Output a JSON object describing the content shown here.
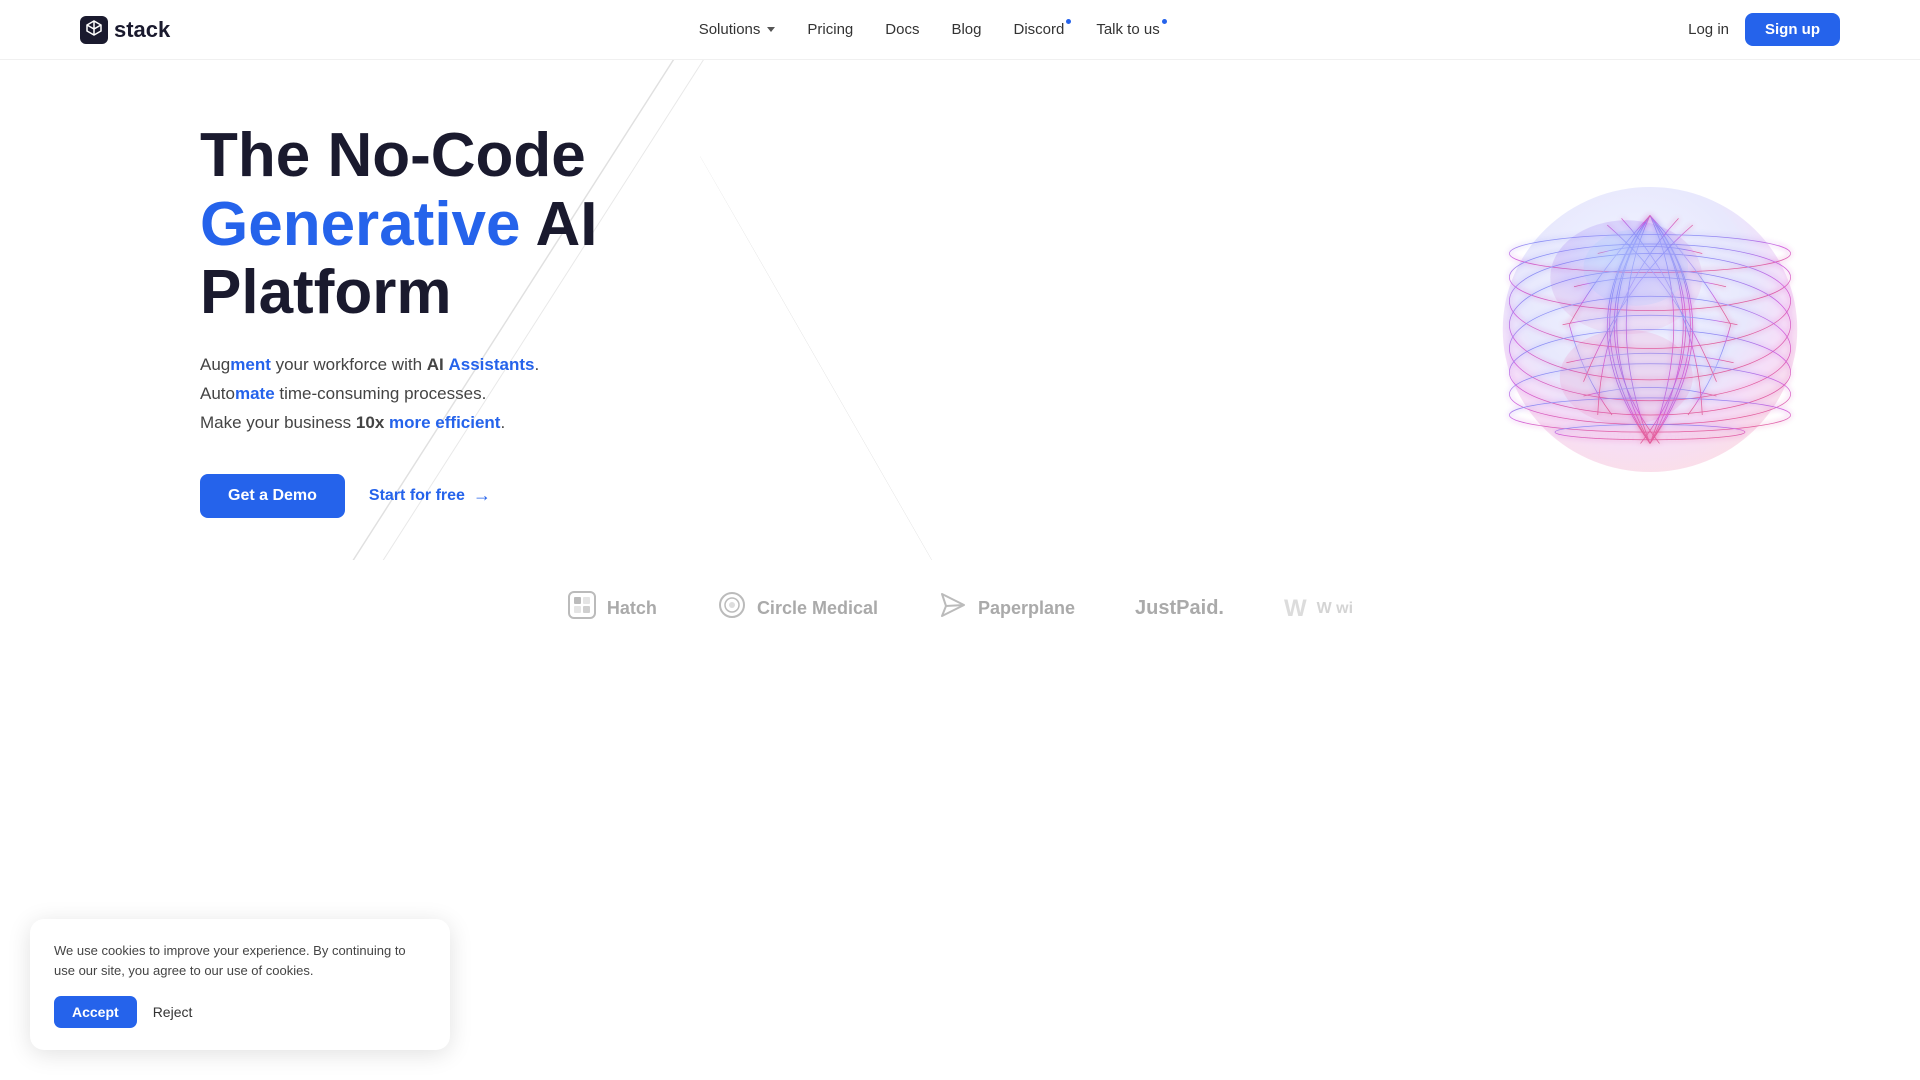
{
  "nav": {
    "logo_text": "stack",
    "links": [
      {
        "label": "Solutions",
        "has_dropdown": true,
        "has_dot": false
      },
      {
        "label": "Pricing",
        "has_dropdown": false,
        "has_dot": false
      },
      {
        "label": "Docs",
        "has_dropdown": false,
        "has_dot": false
      },
      {
        "label": "Blog",
        "has_dropdown": false,
        "has_dot": false
      },
      {
        "label": "Discord",
        "has_dropdown": false,
        "has_dot": true
      },
      {
        "label": "Talk to us",
        "has_dropdown": false,
        "has_dot": true
      }
    ],
    "login_label": "Log in",
    "signup_label": "Sign up"
  },
  "hero": {
    "title_part1": "The No-Code",
    "title_part2_blue": "Generative",
    "title_part2_rest": " AI",
    "title_part3": "Platform",
    "desc_aug": "Aug",
    "desc_ment_blue": "ment",
    "desc_mid": " your workforce with ",
    "desc_ai": "AI ",
    "desc_assistants_blue": "Assistants",
    "desc_dot": ".",
    "desc_auto": "Auto",
    "desc_mate_blue": "mate",
    "desc_time": " time-consuming processes.",
    "desc_make": "Make your business ",
    "desc_10x": "10x ",
    "desc_efficient_blue": "more efficient",
    "desc_period": ".",
    "cta_demo": "Get a Demo",
    "cta_free": "Start for free",
    "cta_arrow": "→"
  },
  "logos": [
    {
      "name": "Hatch",
      "icon": "⊞"
    },
    {
      "name": "Circle Medical",
      "icon": "◎"
    },
    {
      "name": "Paperplane",
      "icon": "✈"
    },
    {
      "name": "JustPaid.",
      "icon": ""
    },
    {
      "name": "W wi",
      "icon": "W"
    }
  ],
  "cookie": {
    "text": "We use cookies to improve your experience. By continuing to use our site, you agree to our use of cookies.",
    "accept_label": "Accept",
    "reject_label": "Reject"
  },
  "colors": {
    "blue": "#2563eb",
    "dark": "#1a1a2e",
    "gray": "#aaa"
  }
}
